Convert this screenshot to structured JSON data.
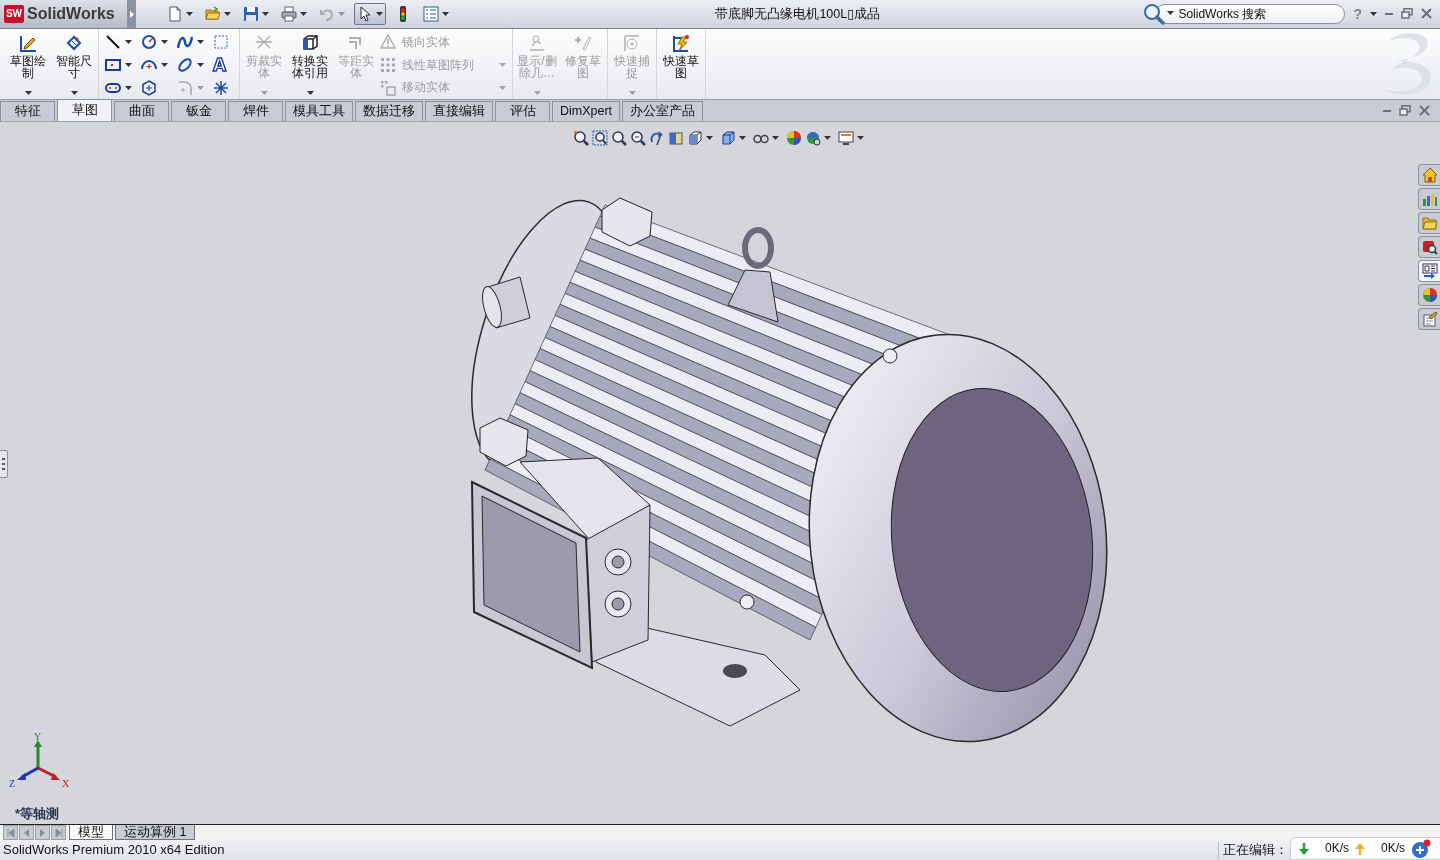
{
  "title_bar": {
    "logo_badge": "SW",
    "app_name": "SolidWorks",
    "document_title": "带底脚无凸缘电机100L▯成品",
    "search": {
      "placeholder": "SolidWorks 搜索"
    },
    "help": "?"
  },
  "quick_access": [
    {
      "kind": "new",
      "dropdown": true,
      "disabled": false,
      "pressed": false
    },
    {
      "kind": "open",
      "dropdown": true,
      "disabled": false,
      "pressed": false
    },
    {
      "kind": "save",
      "dropdown": true,
      "disabled": false,
      "pressed": false
    },
    {
      "kind": "print",
      "dropdown": true,
      "disabled": false,
      "pressed": false
    },
    {
      "kind": "undo",
      "dropdown": true,
      "disabled": true,
      "pressed": false
    },
    {
      "kind": "select",
      "dropdown": true,
      "disabled": false,
      "pressed": true
    },
    {
      "kind": "rebuild",
      "dropdown": false,
      "disabled": false,
      "pressed": false
    },
    {
      "kind": "options",
      "dropdown": true,
      "disabled": false,
      "pressed": false
    }
  ],
  "ribbon": {
    "groups": [
      {
        "items": [
          {
            "kind": "large",
            "label": "草图绘制",
            "disabled": false,
            "dropdown": true
          },
          {
            "kind": "large",
            "label": "智能尺寸",
            "disabled": false,
            "dropdown": true
          }
        ]
      },
      {
        "items": [
          {
            "kind": "tool_grid",
            "tools": [
              {
                "dropdown": true,
                "disabled": false
              },
              {
                "dropdown": true,
                "disabled": false
              },
              {
                "dropdown": true,
                "disabled": false
              },
              {
                "dropdown": false,
                "disabled": false
              },
              {
                "dropdown": true,
                "disabled": false
              },
              {
                "dropdown": true,
                "disabled": false
              },
              {
                "dropdown": true,
                "disabled": false
              },
              {
                "dropdown": false,
                "disabled": false,
                "glyph": "A"
              },
              {
                "dropdown": true,
                "disabled": false
              },
              {
                "dropdown": false,
                "disabled": false
              },
              {
                "dropdown": true,
                "disabled": true
              },
              {
                "dropdown": false,
                "disabled": false
              }
            ]
          }
        ]
      },
      {
        "items": [
          {
            "kind": "large",
            "label": "剪裁实体",
            "disabled": true,
            "dropdown": true
          },
          {
            "kind": "large",
            "label": "转换实体引用",
            "disabled": false,
            "dropdown": true
          },
          {
            "kind": "large",
            "label": "等距实体",
            "disabled": true,
            "dropdown": false
          },
          {
            "kind": "small_list",
            "tools": [
              {
                "label": "镜向实体",
                "disabled": true,
                "dropdown": false
              },
              {
                "label": "线性草图阵列",
                "disabled": true,
                "dropdown": true
              },
              {
                "label": "移动实体",
                "disabled": true,
                "dropdown": true
              }
            ]
          }
        ]
      },
      {
        "items": [
          {
            "kind": "large",
            "label": "显示/删除几…",
            "disabled": true,
            "dropdown": true
          },
          {
            "kind": "large",
            "label": "修复草图",
            "disabled": true,
            "dropdown": false
          }
        ]
      },
      {
        "items": [
          {
            "kind": "large",
            "label": "快速捕捉",
            "disabled": true,
            "dropdown": true
          }
        ]
      },
      {
        "items": [
          {
            "kind": "large",
            "label": "快速草图",
            "disabled": false,
            "dropdown": false
          }
        ]
      }
    ]
  },
  "tabs": [
    {
      "label": "特征",
      "selected": false
    },
    {
      "label": "草图",
      "selected": true
    },
    {
      "label": "曲面",
      "selected": false
    },
    {
      "label": "钣金",
      "selected": false
    },
    {
      "label": "焊件",
      "selected": false
    },
    {
      "label": "模具工具",
      "selected": false
    },
    {
      "label": "数据迁移",
      "selected": false
    },
    {
      "label": "直接编辑",
      "selected": false
    },
    {
      "label": "评估",
      "selected": false
    },
    {
      "label": "DimXpert",
      "selected": false
    },
    {
      "label": "办公室产品",
      "selected": false
    }
  ],
  "task_pane": [
    {
      "selected": false
    },
    {
      "selected": false
    },
    {
      "selected": false
    },
    {
      "selected": false
    },
    {
      "selected": true
    },
    {
      "selected": false
    },
    {
      "selected": false
    }
  ],
  "triad": {
    "y": "Y",
    "x": "X",
    "z": "Z"
  },
  "view_label": "*等轴测",
  "bottom_tabs": [
    {
      "label": "模型",
      "selected": true
    },
    {
      "label": "运动算例 1",
      "selected": false
    }
  ],
  "status_bar": {
    "edition": "SolidWorks Premium 2010 x64 Edition",
    "editing": "正在编辑：",
    "net_monitor": {
      "download": "0K/s",
      "upload": "0K/s"
    }
  }
}
